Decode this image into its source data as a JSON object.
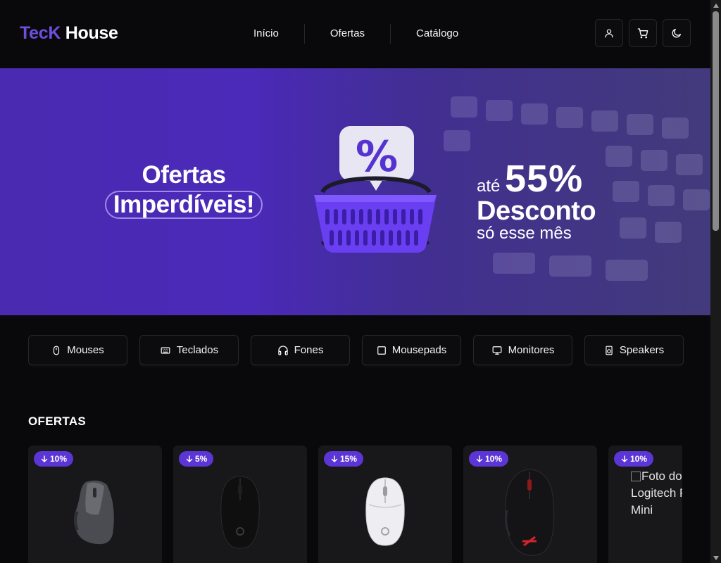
{
  "header": {
    "logo_part1": "TecK",
    "logo_part2": " House",
    "nav": [
      "Início",
      "Ofertas",
      "Catálogo"
    ],
    "icons": [
      "user-icon",
      "cart-icon",
      "moon-icon"
    ]
  },
  "banner": {
    "left_line1": "Ofertas",
    "left_line2": "Imperdíveis!",
    "right_prefix": "até ",
    "right_percent": "55%",
    "right_line2": "Desconto",
    "right_line3": "só esse mês",
    "badge_symbol": "%"
  },
  "categories": [
    {
      "label": "Mouses",
      "icon": "mouse-icon"
    },
    {
      "label": "Teclados",
      "icon": "keyboard-icon"
    },
    {
      "label": "Fones",
      "icon": "headphones-icon"
    },
    {
      "label": "Mousepads",
      "icon": "square-icon"
    },
    {
      "label": "Monitores",
      "icon": "monitor-icon"
    },
    {
      "label": "Speakers",
      "icon": "speaker-icon"
    }
  ],
  "offers": {
    "title": "OFERTAS",
    "products": [
      {
        "discount": "10%",
        "image": "gray-ergonomic-mouse"
      },
      {
        "discount": "5%",
        "image": "black-wireless-mouse"
      },
      {
        "discount": "15%",
        "image": "white-gaming-mouse"
      },
      {
        "discount": "10%",
        "image": "black-red-gaming-mouse"
      },
      {
        "discount": "10%",
        "image_alt": "Foto do produto Logitech Pop Keys Mini"
      }
    ]
  },
  "colors": {
    "accent": "#5b35d5",
    "logo_accent": "#6d4fe0",
    "background": "#09090b",
    "card": "#18181b"
  }
}
